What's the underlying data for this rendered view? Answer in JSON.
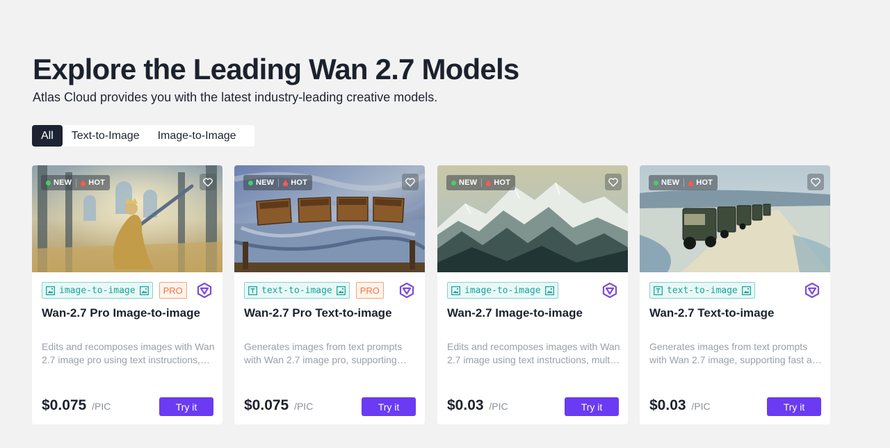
{
  "heading": "Explore the Leading Wan 2.7 Models",
  "subheading": "Atlas Cloud provides you with the latest industry-leading creative models.",
  "filter_tabs": [
    {
      "label": "All",
      "active": true
    },
    {
      "label": "Text-to-Image",
      "active": false
    },
    {
      "label": "Image-to-Image",
      "active": false
    }
  ],
  "flags": {
    "new": "NEW",
    "hot": "HOT"
  },
  "colors": {
    "accent": "#6a3bf2",
    "tag_teal": "#13a79a",
    "pro_orange": "#f3773f",
    "dark": "#1c2433"
  },
  "cards": [
    {
      "image": "knight-in-cathedral",
      "tag": "image-to-image",
      "pro": "PRO",
      "title": "Wan-2.7 Pro Image-to-image",
      "description": "Edits and recomposes images with Wan 2.7 image pro using text instructions, multi-image references and precise control.",
      "price": "$0.075",
      "unit": "/PIC",
      "button": "Try it"
    },
    {
      "image": "wooden-boxes-on-table",
      "tag": "text-to-image",
      "pro": "PRO",
      "title": "Wan-2.7 Pro Text-to-image",
      "description": "Generates images from text prompts with Wan 2.7 image pro, supporting high resolution and rich detail.",
      "price": "$0.075",
      "unit": "/PIC",
      "button": "Try it"
    },
    {
      "image": "snowy-mountains",
      "tag": "image-to-image",
      "pro": "",
      "title": "Wan-2.7 Image-to-image",
      "description": "Edits and recomposes images with Wan 2.7 image using text instructions, multi-image references.",
      "price": "$0.03",
      "unit": "/PIC",
      "button": "Try it"
    },
    {
      "image": "trucks-on-snowy-road",
      "tag": "text-to-image",
      "pro": "",
      "title": "Wan-2.7 Text-to-image",
      "description": "Generates images from text prompts with Wan 2.7 image, supporting fast and affordable generation.",
      "price": "$0.03",
      "unit": "/PIC",
      "button": "Try it"
    }
  ]
}
